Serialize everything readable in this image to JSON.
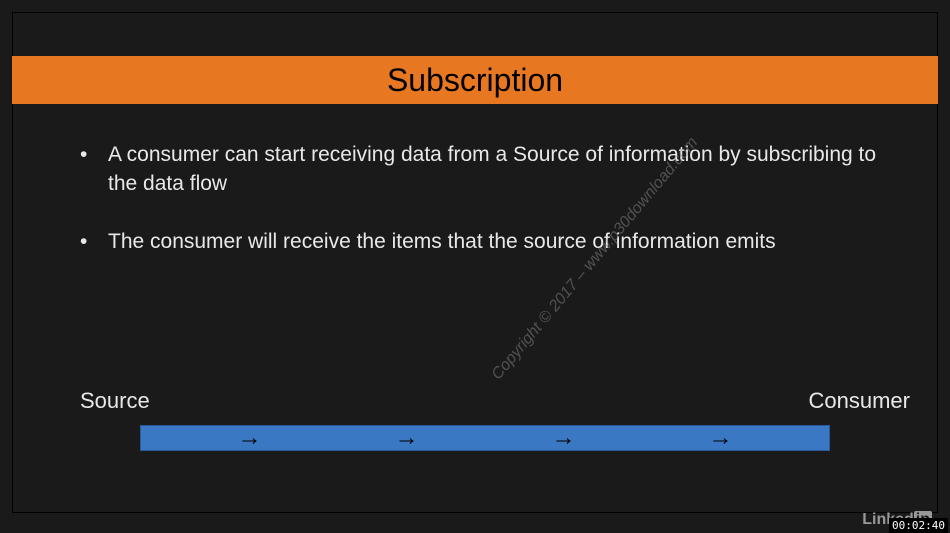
{
  "title": "Subscription",
  "bullets": [
    "A consumer can start receiving data from a Source of information by subscribing to the data flow",
    "The consumer will receive the items that the source of information emits"
  ],
  "labels": {
    "source": "Source",
    "consumer": "Consumer"
  },
  "watermark": "Copyright © 2017 – www.p30download.com",
  "logo": {
    "text": "Linked",
    "suffix": "in"
  },
  "timestamp": "00:02:40",
  "arrows": [
    "→",
    "→",
    "→",
    "→"
  ]
}
